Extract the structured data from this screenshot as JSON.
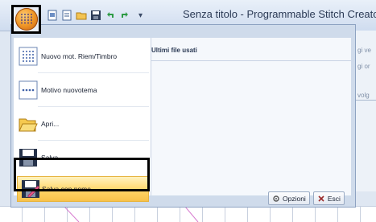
{
  "window": {
    "title": "Senza titolo - Programmable Stitch Creator"
  },
  "quick_access": {
    "icons": [
      "new-file-icon",
      "new-document-icon",
      "open-folder-icon",
      "save-icon",
      "undo-icon",
      "redo-icon"
    ],
    "dropdown_glyph": "▾"
  },
  "menu": {
    "items": [
      {
        "label": "Nuovo mot. Riem/Timbro",
        "icon": "fill-stamp-pattern-icon"
      },
      {
        "label": "Motivo nuovotema",
        "icon": "motif-pattern-icon"
      },
      {
        "label": "Apri...",
        "icon": "open-folder-icon"
      },
      {
        "label": "Salva",
        "icon": "save-icon"
      },
      {
        "label": "Salva con nome...",
        "icon": "save-as-icon",
        "active": true
      }
    ],
    "recent_files_header": "Ultimi file usati",
    "options_label": "Opzioni",
    "exit_label": "Esci"
  },
  "background_fragments": [
    "gi ve",
    "gi or",
    "volg"
  ],
  "colors": {
    "active_item": "#ffd567",
    "orb": "#f29b2a",
    "panel": "#cfdbeb"
  }
}
